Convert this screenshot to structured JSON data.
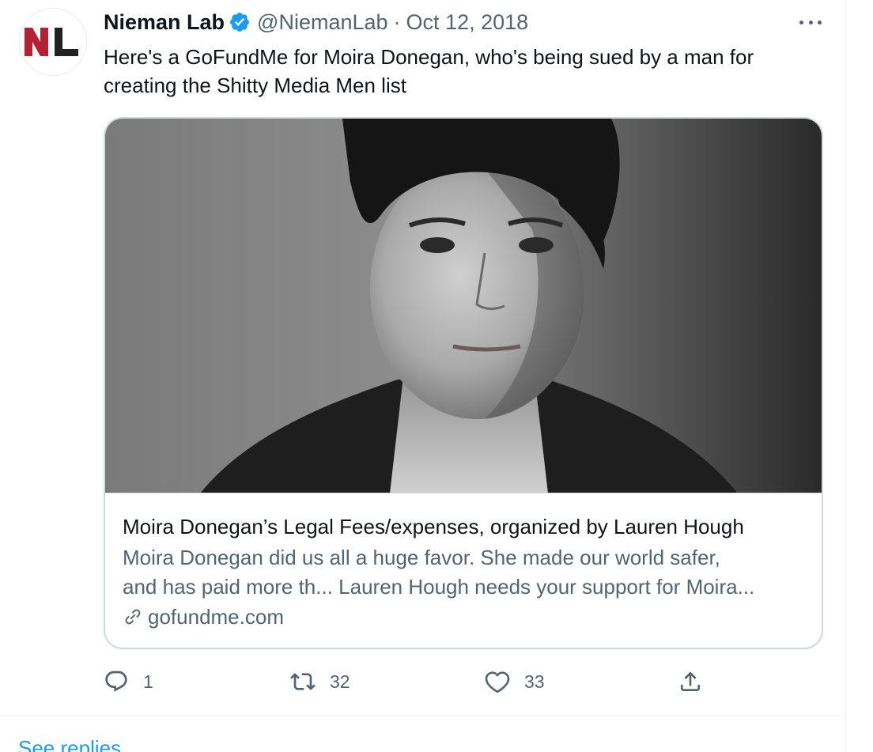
{
  "tweet": {
    "author": {
      "name": "Nieman Lab",
      "handle": "@NiemanLab",
      "avatar_logo_text": "NL",
      "verified": true
    },
    "separator": "·",
    "date": "Oct 12, 2018",
    "text": "Here's a GoFundMe for Moira Donegan, who's being sued by a man for creating the Shitty Media Men list",
    "card": {
      "title": "Moira Donegan’s Legal Fees/expenses, organized by Lauren Hough",
      "description_line1": "Moira Donegan did us all a huge favor. She made our world safer,",
      "description_line2": "and has paid more th... Lauren Hough needs your support for Moira...",
      "domain": "gofundme.com"
    },
    "actions": {
      "replies": "1",
      "retweets": "32",
      "likes": "33"
    },
    "see_replies": "See replies"
  },
  "colors": {
    "text_primary": "#0f1419",
    "text_secondary": "#536471",
    "verified_blue": "#1d9bf0",
    "link_blue": "#1d9bf0",
    "border": "#cfd9de",
    "logo_red": "#b22234",
    "logo_black": "#222222"
  },
  "icons": {
    "verified": "verified-badge-icon",
    "more": "more-horizontal-icon",
    "link": "link-icon",
    "reply": "reply-bubble-icon",
    "retweet": "retweet-icon",
    "like": "heart-icon",
    "share": "share-icon"
  }
}
